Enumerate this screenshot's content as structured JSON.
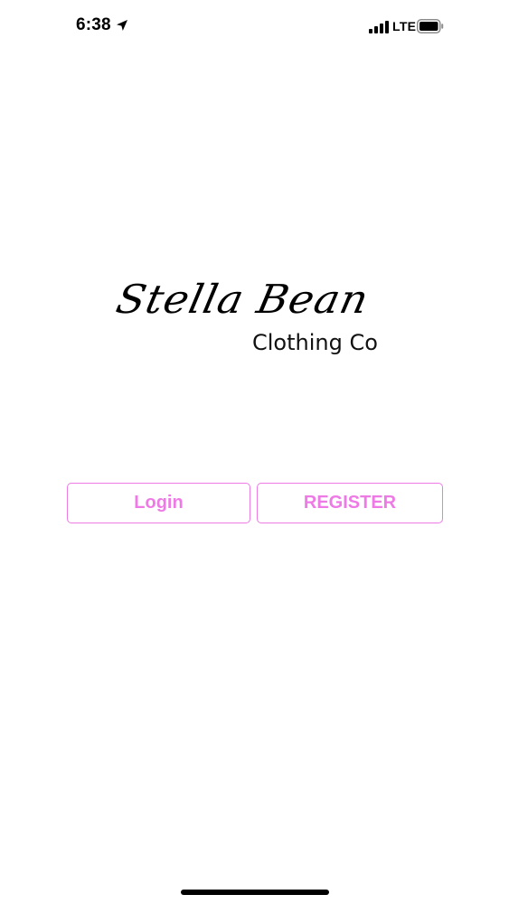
{
  "status_bar": {
    "time": "6:38",
    "network": "LTE",
    "icons": [
      "location-arrow-icon",
      "signal-bars-icon",
      "battery-icon"
    ]
  },
  "logo": {
    "brand_script": "Stella Bean",
    "brand_sub": "Clothing Co"
  },
  "auth": {
    "login_label": "Login",
    "register_label": "REGISTER"
  },
  "colors": {
    "accent": "#ee7ae6",
    "background": "#ffffff",
    "text": "#000000"
  }
}
